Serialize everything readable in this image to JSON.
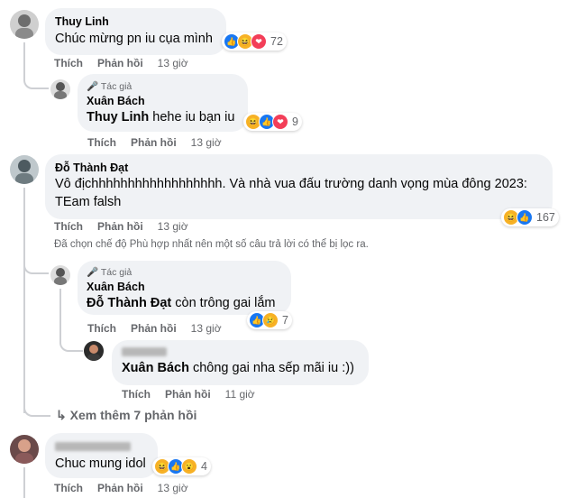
{
  "comments": [
    {
      "author": "Thuy Linh",
      "text": "Chúc mừng pn iu cụa mình",
      "reaction_count": "72",
      "reactions": [
        "like-icon",
        "haha-icon",
        "love-icon"
      ],
      "like": "Thích",
      "reply": "Phản hồi",
      "time": "13 giờ",
      "reply_item": {
        "badge": "Tác giả",
        "author": "Xuân Bách",
        "mention": "Thuy Linh",
        "text": " hehe iu bạn iu",
        "reaction_count": "9",
        "reactions": [
          "haha-icon",
          "like-icon",
          "love-icon"
        ],
        "like": "Thích",
        "reply": "Phản hồi",
        "time": "13 giờ"
      }
    },
    {
      "author": "Đỗ Thành Đạt",
      "text_line1": "Vô địchhhhhhhhhhhhhhhhhh. Và nhà vua đấu trường danh vọng mùa đông 2023:",
      "text_line2": "TEam falsh",
      "reaction_count": "167",
      "reactions": [
        "haha-icon",
        "like-icon"
      ],
      "like": "Thích",
      "reply": "Phản hồi",
      "time": "13 giờ",
      "filter_note": "Đã chọn chế độ Phù hợp nhất nên một số câu trả lời có thể bị lọc ra.",
      "reply_item": {
        "badge": "Tác giả",
        "author": "Xuân Bách",
        "mention": "Đỗ Thành Đạt",
        "text": " còn trông gai lắm",
        "reaction_count": "7",
        "reactions": [
          "like-icon",
          "sad-icon"
        ],
        "like": "Thích",
        "reply": "Phản hồi",
        "time": "13 giờ"
      },
      "nested_reply": {
        "mention": "Xuân Bách",
        "text": " chông gai nha sếp mãi iu :))",
        "like": "Thích",
        "reply": "Phản hồi",
        "time": "11 giờ"
      },
      "more_replies": "Xem thêm 7 phản hồi"
    },
    {
      "text": "Chuc mung idol",
      "reaction_count": "4",
      "reactions": [
        "haha-icon",
        "like-icon",
        "wow-icon"
      ],
      "like": "Thích",
      "reply": "Phản hồi",
      "time": "13 giờ"
    }
  ]
}
